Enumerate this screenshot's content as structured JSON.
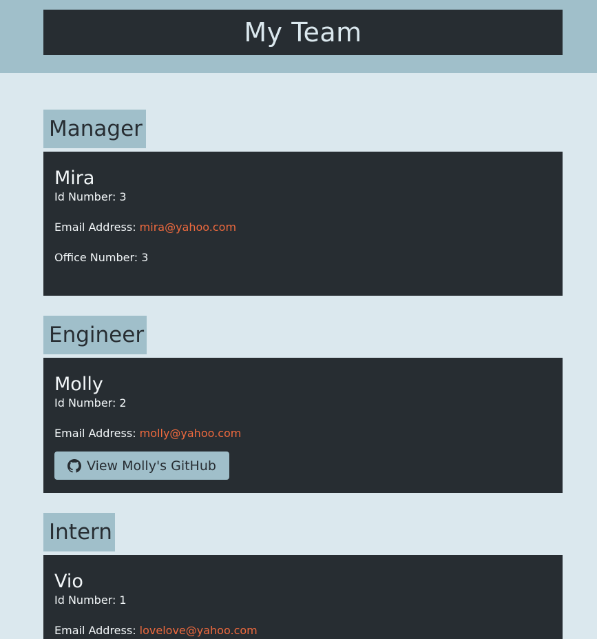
{
  "header": {
    "title": "My Team"
  },
  "colors": {
    "page_bg": "#dbe8ee",
    "accent_band": "#a0bfca",
    "card_bg": "#272d32",
    "link": "#f06a3e"
  },
  "manager": {
    "role": "Manager",
    "name": "Mira",
    "id_line": "Id Number: 3",
    "email_label": "Email Address: ",
    "email": "mira@yahoo.com",
    "office_line": "Office Number: 3"
  },
  "engineer": {
    "role": "Engineer",
    "name": "Molly",
    "id_line": "Id Number: 2",
    "email_label": "Email Address: ",
    "email": "molly@yahoo.com",
    "github_button": "View Molly's GitHub",
    "github_icon": "github-icon"
  },
  "intern": {
    "role": "Intern",
    "name": "Vio",
    "id_line": "Id Number: 1",
    "email_label": "Email Address: ",
    "email": "lovelove@yahoo.com"
  }
}
